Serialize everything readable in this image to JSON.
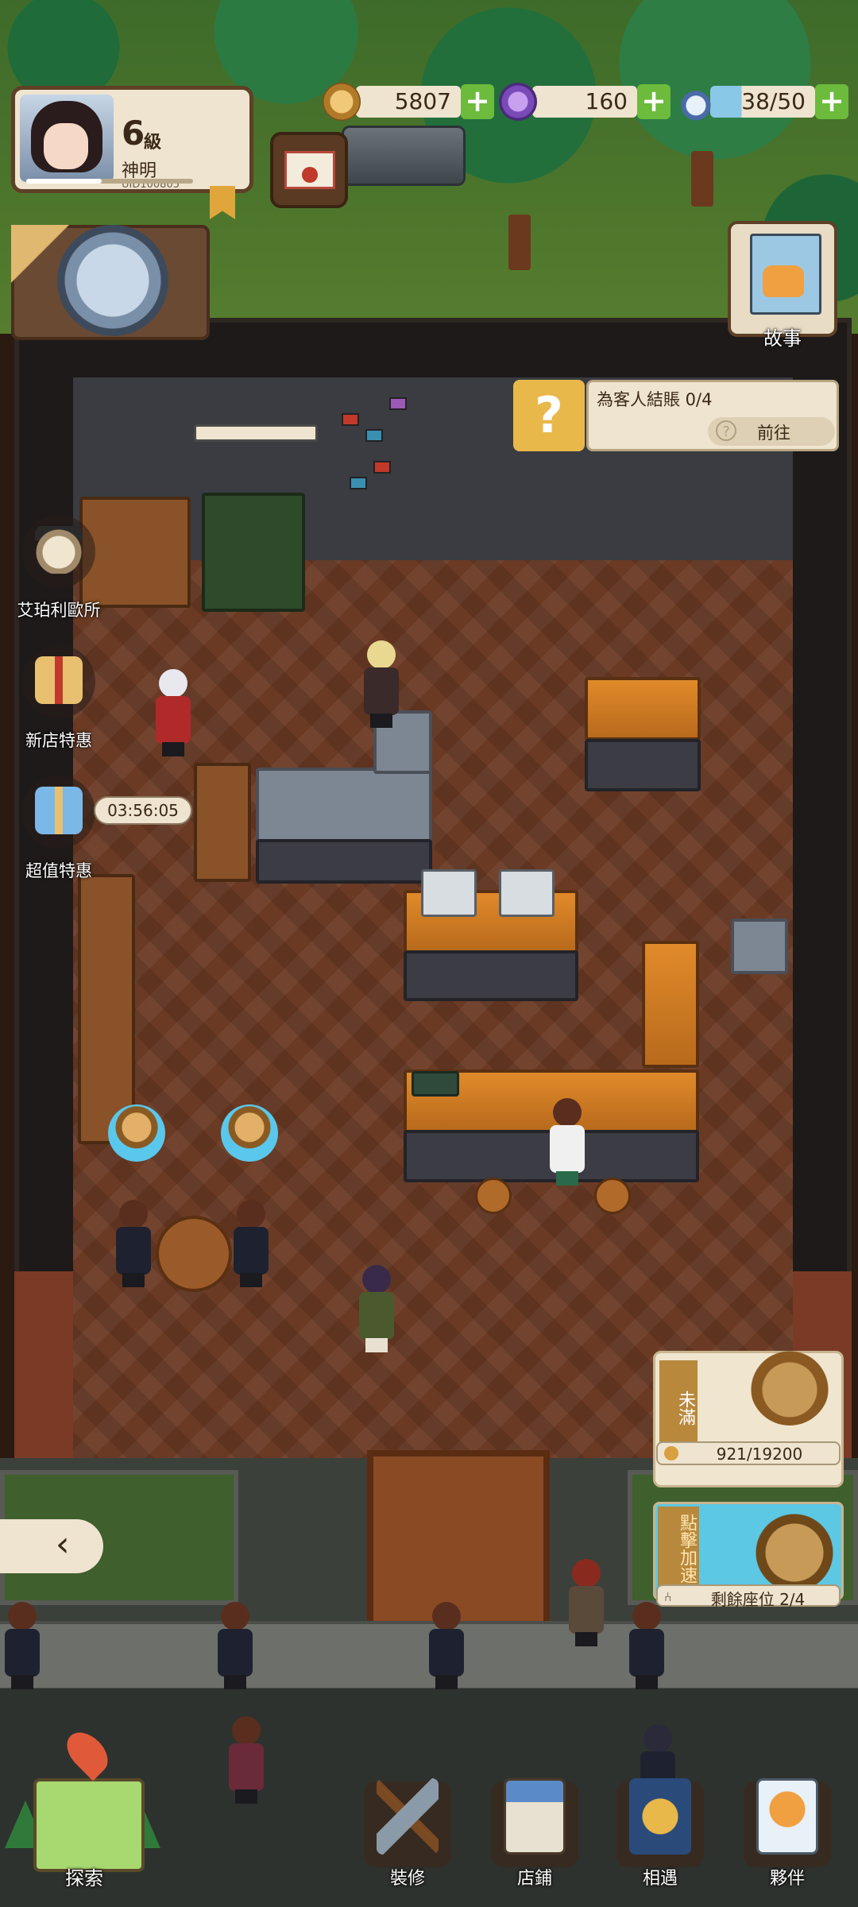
{
  "player": {
    "level": "6",
    "level_unit": "級",
    "name": "神明",
    "uid": "UID100805",
    "xp_fraction": 0.45
  },
  "resources": {
    "coins": "5807",
    "gems": "160",
    "potions": "38/50"
  },
  "story_button": {
    "label": "故事"
  },
  "quest": {
    "text": "為客人結賬 0/4",
    "go_label": "前往",
    "icon_glyph": "?"
  },
  "side_menu": [
    {
      "label": "艾珀利歐所",
      "icon": "owl-icon"
    },
    {
      "label": "新店特惠",
      "icon": "gift-icon"
    },
    {
      "label": "超值特惠",
      "icon": "gift-box-icon"
    }
  ],
  "timer": "03:56:05",
  "earnings": {
    "tag": "未滿",
    "progress": "921/19200"
  },
  "speed_up": {
    "tag": "點擊加速",
    "seats": "剩餘座位 2/4"
  },
  "left_arrow": "‹",
  "bottom_nav": [
    {
      "label": "探索",
      "icon": "map-icon"
    },
    {
      "label": "裝修",
      "icon": "hammer-icon"
    },
    {
      "label": "店鋪",
      "icon": "shop-icon"
    },
    {
      "label": "相遇",
      "icon": "coin-banner-icon"
    },
    {
      "label": "夥伴",
      "icon": "cat-card-icon"
    }
  ],
  "colors": {
    "panel": "#efe4cf",
    "plus": "#6cbb3c",
    "accent_gold": "#e8b84a",
    "bell_glow": "#59c8ec"
  }
}
